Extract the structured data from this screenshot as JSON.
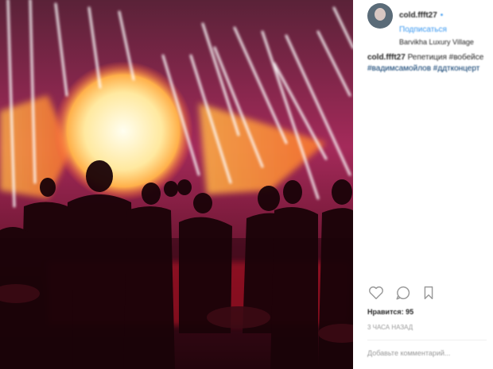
{
  "post": {
    "username": "cold.ffft27",
    "follow_label": "• Подписаться",
    "location": "Barvikha Luxury Village",
    "caption_username": "cold.ffft27",
    "caption_text": "Репетиция #вобейсе",
    "caption_tags": "#вадимсамойлов #ддтконцерт",
    "likes": "Нравится: 95",
    "timestamp": "3 ЧАСА НАЗАД",
    "comment_placeholder": "Добавьте комментарий..."
  },
  "icons": {
    "like": "heart-icon",
    "comment": "comment-icon",
    "save": "bookmark-icon"
  },
  "colors": {
    "link": "#3897f0",
    "stage_glow": "#ffb14a",
    "stage_back": "#c21c5f"
  }
}
